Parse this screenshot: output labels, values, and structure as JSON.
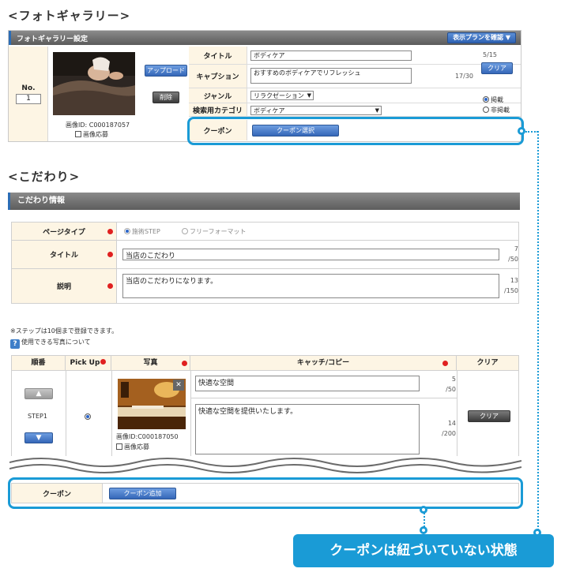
{
  "headings": {
    "gallery": "<フォトギャラリー>",
    "kodawari": "<こだわり>"
  },
  "gallery": {
    "panel_title": "フォトギャラリー設定",
    "plan_button": "表示プランを確認 ▼",
    "no_label": "No.",
    "no_value": "1",
    "upload_button": "アップロード",
    "delete_button": "削除",
    "image_id": "画像ID: C000187057",
    "apply_label": "画像応募",
    "title_label": "タイトル",
    "title_value": "ボディケア",
    "title_count": "5/15",
    "caption_label": "キャプション",
    "caption_value": "おすすめのボディケアでリフレッシュ",
    "caption_count": "17/30",
    "clear_button": "クリア",
    "genre_label": "ジャンル",
    "genre_value": "リラクゼーション",
    "category_label": "検索用カテゴリ",
    "category_value": "ボディケア",
    "publish": "掲載",
    "unpublish": "非掲載",
    "coupon_label": "クーポン",
    "coupon_select_button": "クーポン選択"
  },
  "kodawari": {
    "panel_title": "こだわり情報",
    "pagetype_label": "ページタイプ",
    "pagetype_options": [
      "施術STEP",
      "フリーフォーマット"
    ],
    "title_label": "タイトル",
    "title_value": "当店のこだわり",
    "title_count": "7",
    "title_max": "/50",
    "desc_label": "説明",
    "desc_value": "当店のこだわりになります。",
    "desc_count": "13",
    "desc_max": "/150",
    "note": "※ステップは10個まで登録できます。",
    "help_text": "使用できる写真について",
    "help_icon": "?",
    "columns": {
      "order": "順番",
      "pickup": "Pick Up",
      "photo": "写真",
      "catch": "キャッチ/コピー",
      "clear": "クリア"
    },
    "step_label": "STEP1",
    "photo_id": "画像ID:C000187050",
    "apply_label": "画像応募",
    "close_glyph": "✕",
    "catch_value": "快適な空間",
    "catch_count": "5",
    "catch_max": "/50",
    "copy_value": "快適な空間を提供いたします。",
    "copy_count": "14",
    "copy_max": "/200",
    "clear_button": "クリア",
    "coupon_label": "クーポン",
    "coupon_add_button": "クーポン追加"
  },
  "callout": "クーポンは紐づいていない状態",
  "colors": {
    "accent": "#1a9bd6",
    "label_bg": "#fdf5e4",
    "required": "#e02020"
  }
}
